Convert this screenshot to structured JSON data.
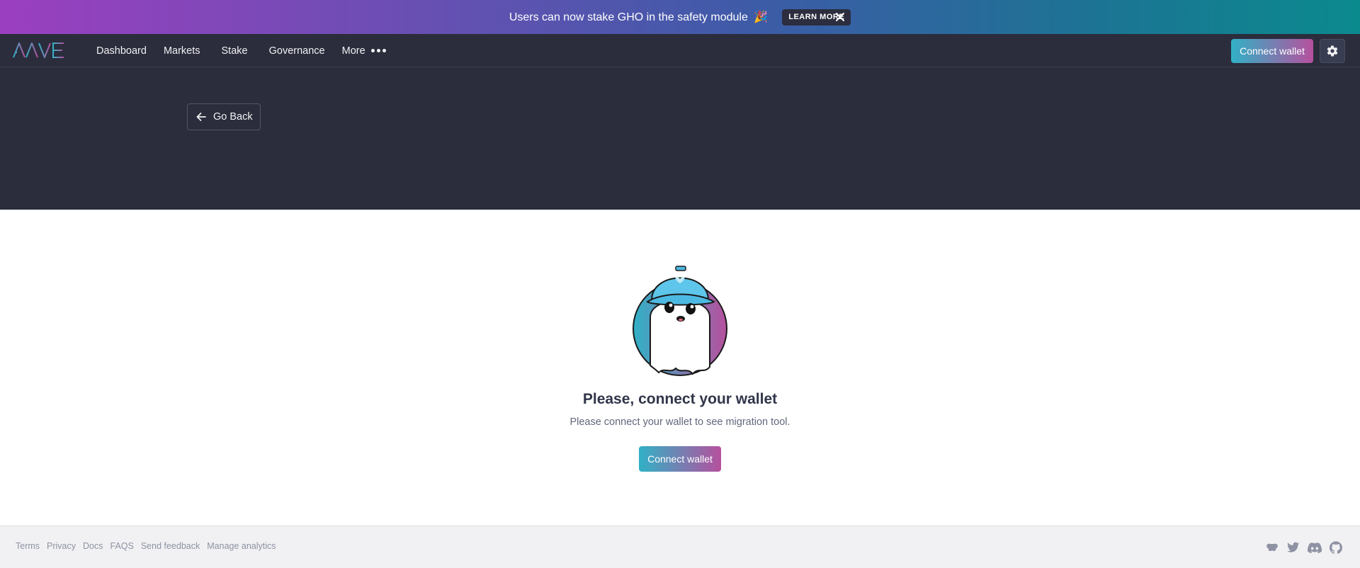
{
  "banner": {
    "text": "Users can now stake GHO in the safety module",
    "emoji": "🎉",
    "learn_more": "LEARN MORE",
    "close_icon": "close-icon"
  },
  "header": {
    "logo": "AAVE",
    "nav": [
      {
        "label": "Dashboard"
      },
      {
        "label": "Markets"
      },
      {
        "label": "Stake"
      },
      {
        "label": "Governance"
      },
      {
        "label": "More"
      }
    ],
    "connect_wallet": "Connect wallet",
    "settings_icon": "gear-icon"
  },
  "hero": {
    "go_back": "Go Back"
  },
  "main": {
    "title": "Please, connect your wallet",
    "subtitle": "Please connect your wallet to see migration tool.",
    "connect_wallet": "Connect wallet"
  },
  "footer": {
    "links": [
      "Terms",
      "Privacy",
      "Docs",
      "FAQS",
      "Send feedback",
      "Manage analytics"
    ],
    "icons": [
      "lens-icon",
      "twitter-icon",
      "discord-icon",
      "github-icon"
    ]
  },
  "colors": {
    "brand_teal": "#31b1c6",
    "brand_purple": "#b6509e",
    "header_bg": "#2b2d3c"
  }
}
